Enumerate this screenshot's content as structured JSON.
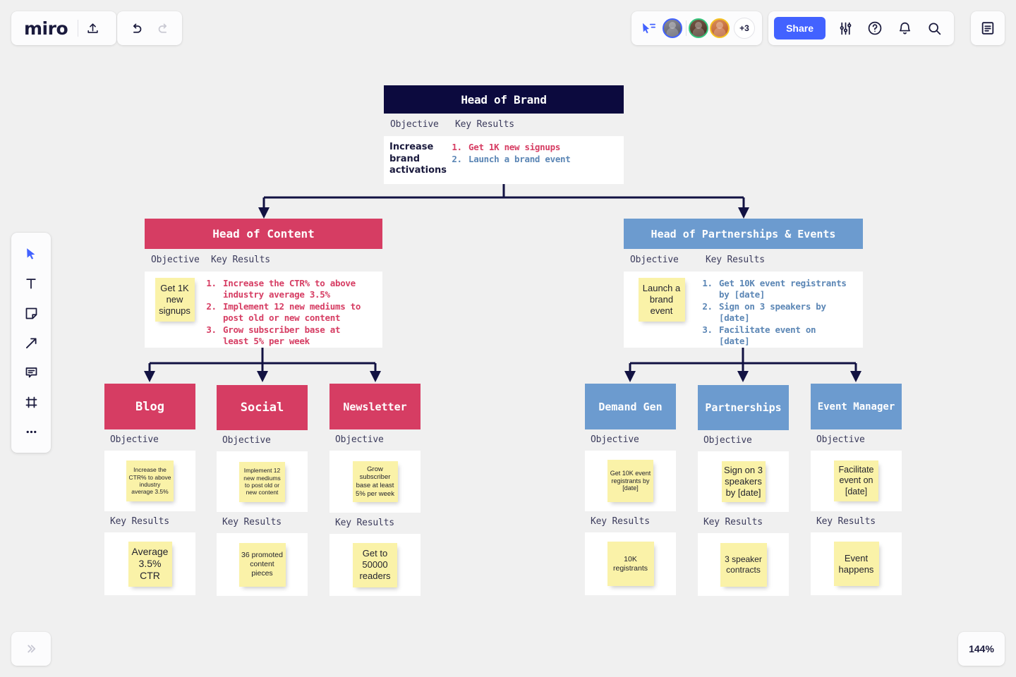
{
  "app": {
    "name": "miro",
    "zoom_level": "144%",
    "collaborator_overflow": "+3"
  },
  "toolbar_top": {
    "upload_label": "upload-icon",
    "undo_label": "undo-icon",
    "redo_label": "redo-icon",
    "share_label": "Share",
    "settings_label": "sliders-icon",
    "help_label": "help-icon",
    "notifications_label": "bell-icon",
    "search_label": "search-icon",
    "document_label": "document-icon",
    "cursor_share_label": "cursor-share-icon"
  },
  "toolbar_left": {
    "items": [
      {
        "name": "select-tool",
        "label": "Select"
      },
      {
        "name": "text-tool",
        "label": "Text"
      },
      {
        "name": "sticky-note-tool",
        "label": "Sticky note"
      },
      {
        "name": "connector-tool",
        "label": "Connection line"
      },
      {
        "name": "comment-tool",
        "label": "Comment"
      },
      {
        "name": "frame-tool",
        "label": "Frame"
      },
      {
        "name": "more-tools",
        "label": "More tools"
      }
    ]
  },
  "bottom_left": {
    "expand_label": "expand-panel-icon"
  },
  "colors": {
    "dark": "#0C0A3E",
    "pink": "#D63D63",
    "blue": "#6C9BCF",
    "sticky": "#FAF2A8",
    "accent": "#4262FF",
    "canvas": "#F0F0F0"
  },
  "board": {
    "column_headers": {
      "objective": "Objective",
      "key_results": "Key Results"
    },
    "root": {
      "title": "Head of Brand",
      "objective": "Increase brand activations",
      "key_results": [
        {
          "text": "Get 1K new signups",
          "color": "pink"
        },
        {
          "text": "Launch a brand event",
          "color": "blue"
        }
      ]
    },
    "branches": [
      {
        "title": "Head of Content",
        "theme": "pink",
        "objective_sticky": "Get 1K new signups",
        "key_results": [
          "Increase the CTR% to above industry average 3.5%",
          "Implement 12 new mediums to post old or new content",
          "Grow subscriber base at least 5% per week"
        ]
      },
      {
        "title": "Head of Partnerships & Events",
        "theme": "blue",
        "objective_sticky": "Launch a brand event",
        "key_results": [
          "Get 10K event registrants by [date]",
          "Sign on 3 speakers by [date]",
          "Facilitate event on [date]"
        ]
      }
    ],
    "leaves": [
      {
        "title": "Blog",
        "theme": "pink",
        "objective_label": "Objective",
        "objective_sticky": "Increase the CTR% to above industry average 3.5%",
        "key_results_label": "Key Results",
        "key_results_sticky": "Average 3.5% CTR"
      },
      {
        "title": "Social",
        "theme": "pink",
        "objective_label": "Objective",
        "objective_sticky": "Implement 12 new mediums to post old or new content",
        "key_results_label": "Key Results",
        "key_results_sticky": "36 promoted content pieces"
      },
      {
        "title": "Newsletter",
        "theme": "pink",
        "objective_label": "Objective",
        "objective_sticky": "Grow subscriber base at least 5% per week",
        "key_results_label": "Key Results",
        "key_results_sticky": "Get to 50000 readers"
      },
      {
        "title": "Demand Gen",
        "theme": "blue",
        "objective_label": "Objective",
        "objective_sticky": "Get 10K event registrants by [date]",
        "key_results_label": "Key Results",
        "key_results_sticky": "10K registrants"
      },
      {
        "title": "Partnerships",
        "theme": "blue",
        "objective_label": "Objective",
        "objective_sticky": "Sign on 3 speakers by [date]",
        "key_results_label": "Key Results",
        "key_results_sticky": "3 speaker contracts"
      },
      {
        "title": "Event Manager",
        "theme": "blue",
        "objective_label": "Objective",
        "objective_sticky": "Facilitate event on [date]",
        "key_results_label": "Key Results",
        "key_results_sticky": "Event happens"
      }
    ]
  }
}
